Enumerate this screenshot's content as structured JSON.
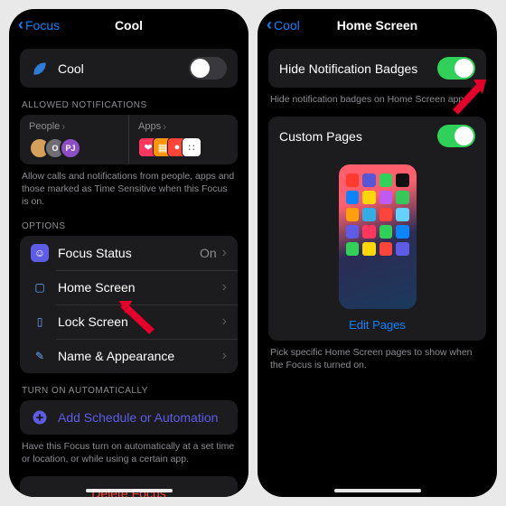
{
  "left": {
    "back": "Focus",
    "title": "Cool",
    "focusRow": {
      "name": "Cool",
      "iconColor": "#2f7bd8"
    },
    "allowedHeader": "ALLOWED NOTIFICATIONS",
    "people": {
      "label": "People",
      "avatars": [
        {
          "bg": "#d4a05a",
          "txt": ""
        },
        {
          "bg": "#6e6e73",
          "txt": "O"
        },
        {
          "bg": "#8e4ec6",
          "txt": "PJ"
        }
      ]
    },
    "apps": {
      "label": "Apps",
      "tiles": [
        {
          "bg": "#ff375f",
          "g": "❤"
        },
        {
          "bg": "#ff9500",
          "g": "▦"
        },
        {
          "bg": "#ff453a",
          "g": "●"
        },
        {
          "bg": "#ffffff",
          "g": "∷"
        }
      ]
    },
    "allowedFooter": "Allow calls and notifications from people, apps and those marked as Time Sensitive when this Focus is on.",
    "optionsHeader": "OPTIONS",
    "options": [
      {
        "key": "focus-status",
        "icon": "focusstatus-icon",
        "bg": "#5e5ce6",
        "g": "☺",
        "label": "Focus Status",
        "value": "On"
      },
      {
        "key": "home-screen",
        "icon": "homescreen-icon",
        "bg": "#1c1c1e",
        "g": "▢",
        "label": "Home Screen",
        "value": ""
      },
      {
        "key": "lock-screen",
        "icon": "lockscreen-icon",
        "bg": "#1c1c1e",
        "g": "▯",
        "label": "Lock Screen",
        "value": ""
      },
      {
        "key": "name-appearance",
        "icon": "appearance-icon",
        "bg": "#1c1c1e",
        "g": "✎",
        "label": "Name & Appearance",
        "value": ""
      }
    ],
    "autoHeader": "TURN ON AUTOMATICALLY",
    "autoAdd": "Add Schedule or Automation",
    "autoFooter": "Have this Focus turn on automatically at a set time or location, or while using a certain app.",
    "delete": "Delete Focus"
  },
  "right": {
    "back": "Cool",
    "title": "Home Screen",
    "hideBadges": {
      "label": "Hide Notification Badges",
      "on": true
    },
    "hideFooter": "Hide notification badges on Home Screen apps.",
    "customPages": {
      "label": "Custom Pages",
      "on": true
    },
    "editPages": "Edit Pages",
    "pagesFooter": "Pick specific Home Screen pages to show when the Focus is turned on.",
    "previewApps": [
      "#ff3b30",
      "#5856d6",
      "#30d158",
      "#111",
      "#0a84ff",
      "#ffd60a",
      "#bf5af2",
      "#34c759",
      "#ff9f0a",
      "#32ade6",
      "#ff453a",
      "#64d2ff",
      "#5e5ce6",
      "#ff375f",
      "#30d158",
      "#0a84ff",
      "#30d158",
      "#ffd60a",
      "#ff453a",
      "#5e5ce6"
    ]
  }
}
